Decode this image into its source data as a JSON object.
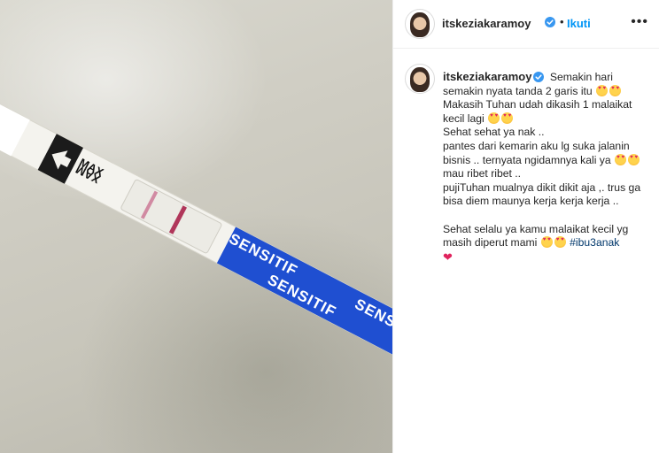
{
  "header": {
    "username": "itskeziakaramoy",
    "separator": "•",
    "follow_label": "Ikuti",
    "more_label": "•••"
  },
  "photo": {
    "strip_labels": [
      "MAX",
      "MAX",
      "SENSITIF",
      "SENSITIF",
      "SENSITIF"
    ]
  },
  "caption": {
    "username": "itskeziakaramoy",
    "line1": "Semakin hari semakin nyata tanda 2 garis itu",
    "line2": "Makasih Tuhan udah dikasih 1 malaikat kecil lagi",
    "line3": "Sehat sehat ya nak ..",
    "line4": "pantes dari kemarin aku lg suka jalanin bisnis .. ternyata ngidamnya kali ya",
    "line4b": "mau ribet ribet ..",
    "line5": "pujiTuhan mualnya dikit dikit aja ,. trus ga bisa diem maunya kerja kerja kerja ..",
    "line6": "Sehat selalu ya kamu malaikat kecil yg masih diperut mami",
    "hashtag": "#ibu3anak",
    "heart": "❤"
  },
  "colors": {
    "accent": "#0095f6",
    "verified": "#3897f0",
    "hashtag": "#00376b",
    "strip_blue": "#1f4fd1",
    "test_line": "#b0365a"
  },
  "icons": [
    "verified-badge-icon",
    "smiling-face-with-heart-eyes-emoji",
    "red-heart-emoji",
    "more-options-icon"
  ]
}
